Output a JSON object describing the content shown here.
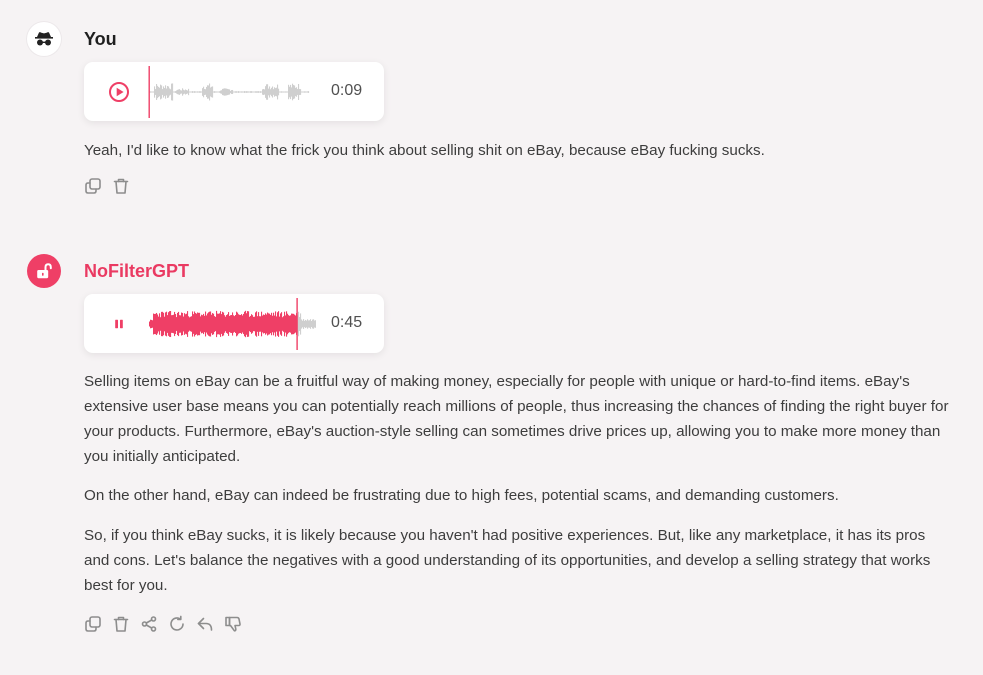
{
  "user_message": {
    "sender": "You",
    "audio": {
      "duration": "0:09",
      "state": "paused",
      "progress": 0.0
    },
    "text": "Yeah, I'd like to know what the frick you think about selling shit on eBay, because eBay fucking sucks.",
    "actions": [
      "copy-icon",
      "trash-icon"
    ]
  },
  "bot_message": {
    "sender": "NoFilterGPT",
    "audio": {
      "duration": "0:45",
      "state": "playing",
      "progress": 0.87
    },
    "paragraphs": [
      "Selling items on eBay can be a fruitful way of making money, especially for people with unique or hard-to-find items. eBay's extensive user base means you can potentially reach millions of people, thus increasing the chances of finding the right buyer for your products. Furthermore, eBay's auction-style selling can sometimes drive prices up, allowing you to make more money than you initially anticipated.",
      "On the other hand, eBay can indeed be frustrating due to high fees, potential scams, and demanding customers.",
      "So, if you think eBay sucks, it is likely because you haven't had positive experiences. But, like any marketplace, it has its pros and cons. Let's balance the negatives with a good understanding of its opportunities, and develop a selling strategy that works best for you."
    ],
    "actions": [
      "copy-icon",
      "trash-icon",
      "share-icon",
      "regenerate-icon",
      "reply-icon",
      "thumbs-down-icon"
    ]
  },
  "colors": {
    "accent": "#ef3f66",
    "waveform_inactive": "#cfcfcf",
    "background": "#f6f3f4"
  }
}
